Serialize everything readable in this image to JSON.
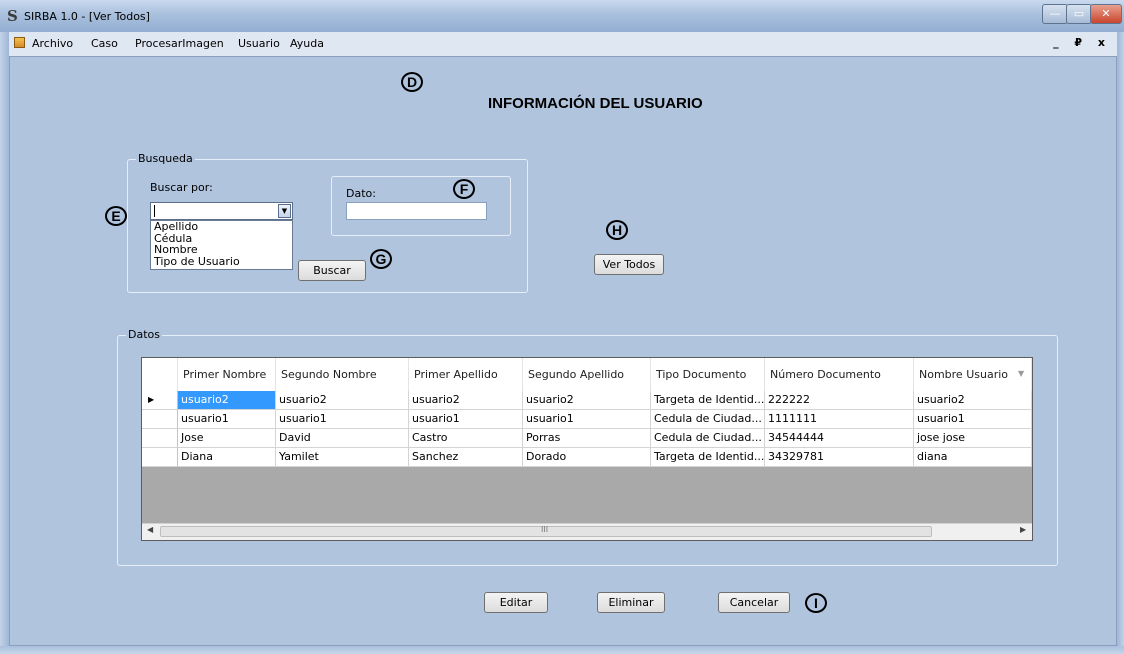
{
  "window": {
    "title": "SIRBA 1.0 - [Ver Todos]",
    "app_icon": "S",
    "controls": {
      "minimize": "—",
      "maximize": "▭",
      "close": "✕"
    }
  },
  "menubar": {
    "items": [
      "Archivo",
      "Caso",
      "ProcesarImagen",
      "Usuario",
      "Ayuda"
    ],
    "mdi_controls": "_ ₽ x"
  },
  "page_title": "INFORMACIÓN DEL USUARIO",
  "markers": {
    "d": "D",
    "e": "E",
    "f": "F",
    "g": "G",
    "h": "H",
    "i": "I"
  },
  "search": {
    "group_label": "Busqueda",
    "buscar_por_label": "Buscar por:",
    "combo_value": "",
    "options": [
      "Apellido",
      "Cédula",
      "Nombre",
      "Tipo de Usuario"
    ],
    "dato_label": "Dato:",
    "dato_value": "",
    "buscar_button": "Buscar"
  },
  "ver_todos_button": "Ver Todos",
  "datos": {
    "group_label": "Datos",
    "columns": [
      "Primer Nombre",
      "Segundo Nombre",
      "Primer Apellido",
      "Segundo Apellido",
      "Tipo Documento",
      "Número Documento",
      "Nombre Usuario"
    ],
    "rows": [
      [
        "usuario2",
        "usuario2",
        "usuario2",
        "usuario2",
        "Targeta de Identid...",
        "222222",
        "usuario2"
      ],
      [
        "usuario1",
        "usuario1",
        "usuario1",
        "usuario1",
        "Cedula de Ciudad...",
        "1111111",
        "usuario1"
      ],
      [
        "Jose",
        "David",
        "Castro",
        "Porras",
        "Cedula de Ciudad...",
        "34544444",
        "jose jose"
      ],
      [
        "Diana",
        "Yamilet",
        "Sanchez",
        "Dorado",
        "Targeta de Identid...",
        "34329781",
        "diana"
      ]
    ],
    "selected_row": 0,
    "scroll_thumb_label": "III"
  },
  "actions": {
    "editar": "Editar",
    "eliminar": "Eliminar",
    "cancelar": "Cancelar"
  }
}
